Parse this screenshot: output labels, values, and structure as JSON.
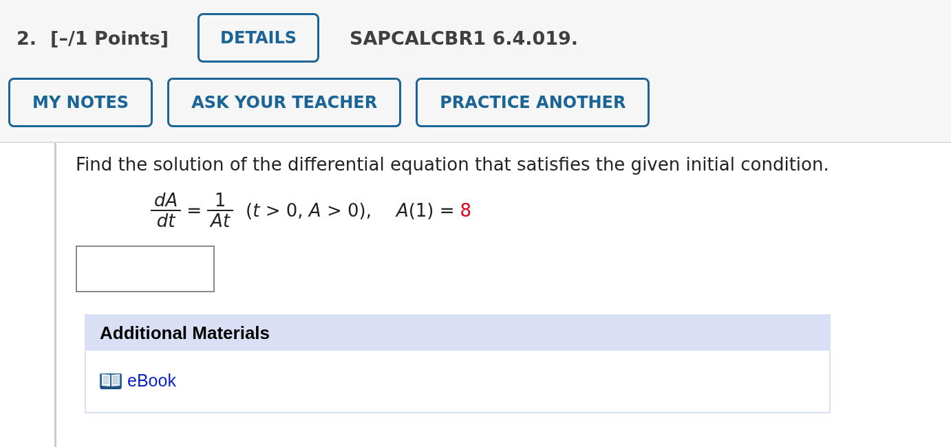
{
  "question": {
    "number": "2.",
    "points": "[–/1 Points]",
    "details_button": "DETAILS",
    "code": "SAPCALCBR1 6.4.019."
  },
  "actions": [
    {
      "label": "MY NOTES"
    },
    {
      "label": "ASK YOUR TEACHER"
    },
    {
      "label": "PRACTICE ANOTHER"
    }
  ],
  "prompt": "Find the solution of the differential equation that satisfies the given initial condition.",
  "equation": {
    "lhs": {
      "numerator": "dA",
      "denominator": "dt"
    },
    "relation": "=",
    "rhs": {
      "numerator": "1",
      "denominator": "At"
    },
    "condition": "(*t* > 0, *A* > 0),",
    "initial_condition": "*A*(1) =",
    "initial_value": "8"
  },
  "answer_fields": [
    {
      "kind": "text"
    }
  ],
  "additional_materials": {
    "title": "Additional Materials",
    "items": [
      {
        "kind": "ebook",
        "label": "eBook"
      }
    ]
  }
}
